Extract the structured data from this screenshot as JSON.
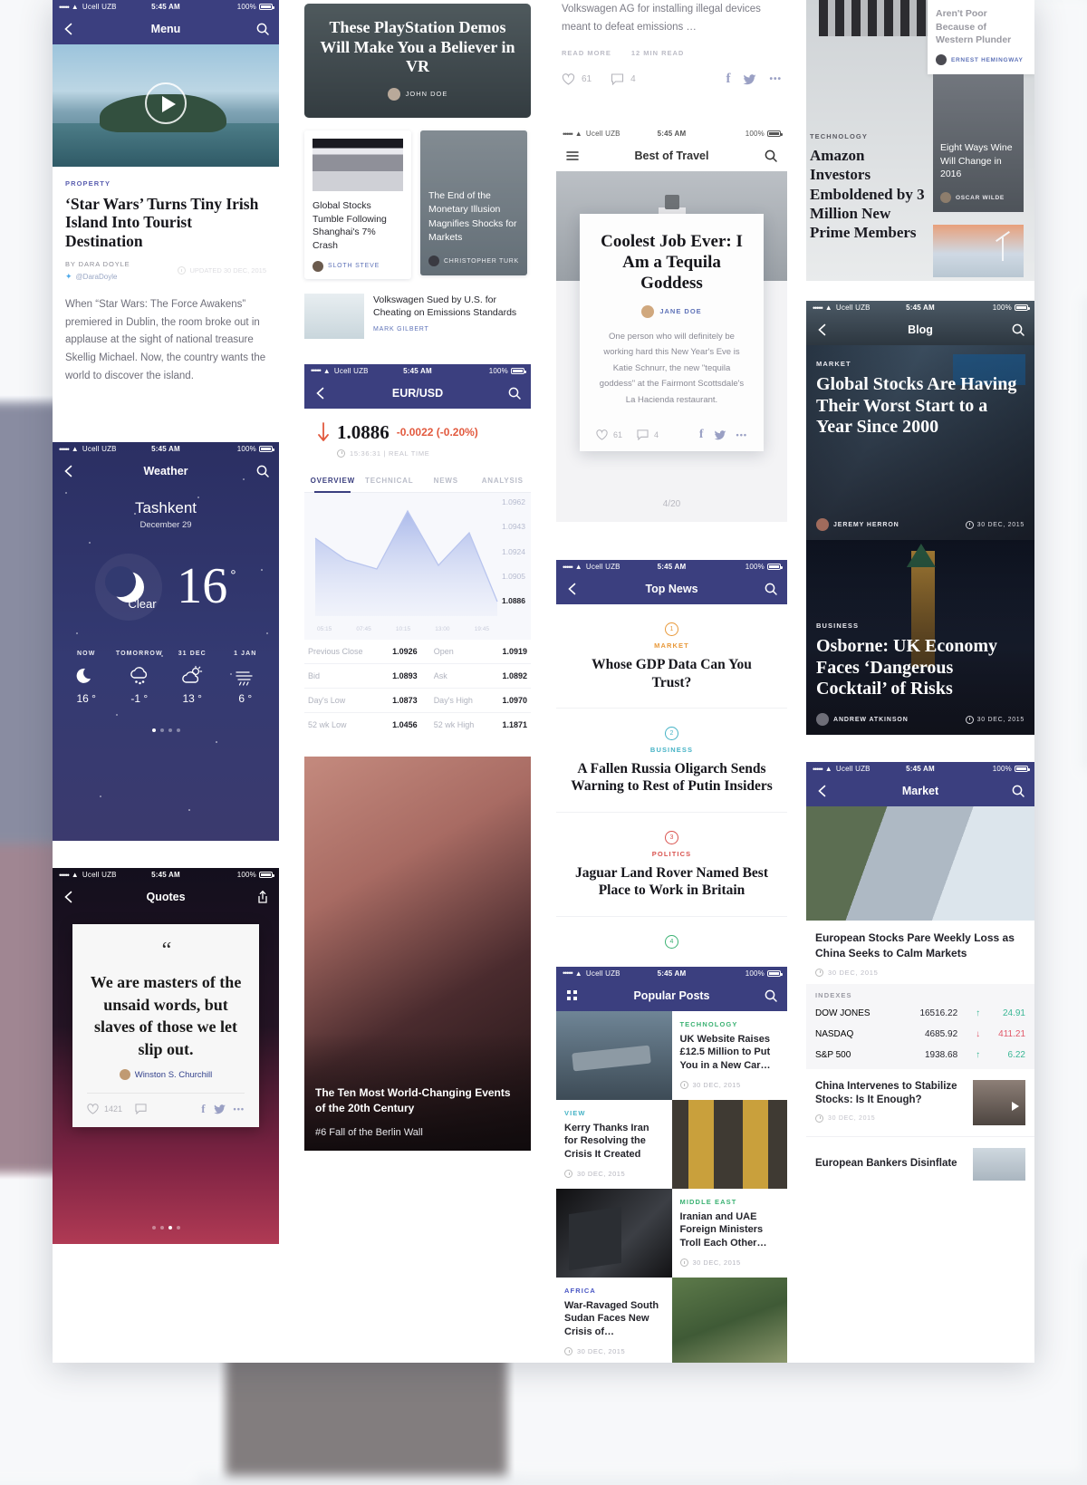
{
  "status_bar": {
    "carrier": "Ucell UZB",
    "time": "5:45 AM",
    "battery": "100%",
    "dots": "•••••"
  },
  "col1": {
    "menu_screen": {
      "nav_title": "Menu",
      "back_icon": "chevron-left-icon",
      "search_icon": "search-icon",
      "hero_icon": "play-icon",
      "kicker": "PROPERTY",
      "headline": "‘Star Wars’ Turns Tiny Irish Island Into Tourist Destination",
      "byline": "BY DARA DOYLE",
      "twitter_handle": "@DaraDoyle",
      "updated": "UPDATED 30 DEC, 2015",
      "body": "When “Star Wars: The Force Awakens” premiered in Dublin, the room broke out in applause at the sight of national treasure Skellig Michael. Now, the country wants the world to discover the island."
    },
    "weather_screen": {
      "nav_title": "Weather",
      "city": "Tashkent",
      "date": "December 29",
      "temp": "16",
      "degree": "°",
      "condition": "Clear",
      "forecast": [
        {
          "label": "NOW",
          "icon": "moon-icon",
          "temp": "16 °"
        },
        {
          "label": "TOMORROW",
          "icon": "snow-cloud-icon",
          "temp": "-1 °"
        },
        {
          "label": "31 DEC",
          "icon": "sun-cloud-icon",
          "temp": "13 °"
        },
        {
          "label": "1 JAN",
          "icon": "wind-rain-icon",
          "temp": "6 °"
        }
      ],
      "page_dots": 4,
      "page_active": 1
    },
    "quotes_screen": {
      "nav_title": "Quotes",
      "share_icon": "share-icon",
      "quote_mark": "“",
      "quote": "We are masters of the unsaid words, but slaves of those we let slip out.",
      "author": "Winston S. Churchill",
      "likes": "1421",
      "comment_icon": "comment-icon",
      "facebook_icon": "facebook-icon",
      "twitter_icon": "twitter-icon",
      "more_icon": "more-icon",
      "page_dots": 4,
      "page_active": 3
    }
  },
  "col2": {
    "feature_card": {
      "title": "These PlayStation Demos Will Make You a Believer in VR",
      "author": "JOHN DOE"
    },
    "small_cards": [
      {
        "title": "Global Stocks Tumble Following Shanghai's 7% Crash",
        "author": "SLOTH STEVE",
        "style": "light"
      },
      {
        "title": "The End of the Monetary Illusion Magnifies Shocks for Markets",
        "author": "CHRISTOPHER TURK",
        "style": "photo"
      }
    ],
    "list_card": {
      "title": "Volkswagen Sued by U.S. for Cheating on Emissions Standards",
      "author": "MARK GILBERT"
    },
    "forex_screen": {
      "nav_title": "EUR/USD",
      "price": "1.0886",
      "change": "-0.0022 (-0.20%)",
      "arrow_icon": "arrow-down-icon",
      "timestamp": "15:36:31 | REAL TIME",
      "tabs": [
        "OVERVIEW",
        "TECHNICAL",
        "NEWS",
        "ANALYSIS"
      ],
      "active_tab": "OVERVIEW",
      "stats": [
        {
          "l1": "Previous Close",
          "v1": "1.0926",
          "l2": "Open",
          "v2": "1.0919"
        },
        {
          "l1": "Bid",
          "v1": "1.0893",
          "l2": "Ask",
          "v2": "1.0892"
        },
        {
          "l1": "Day's Low",
          "v1": "1.0873",
          "l2": "Day's High",
          "v2": "1.0970"
        },
        {
          "l1": "52 wk Low",
          "v1": "1.0456",
          "l2": "52 wk High",
          "v2": "1.1871"
        }
      ]
    },
    "berlin_card": {
      "title": "The Ten Most World-Changing Events of the 20th Century",
      "subtitle": "#6 Fall of the Berlin Wall"
    }
  },
  "col3": {
    "article_tail": {
      "body": "Volkswagen AG for installing illegal devices meant to defeat emissions …",
      "read_more": "READ MORE",
      "read_time": "12 MIN READ",
      "likes": "61",
      "comments": "4",
      "facebook_icon": "facebook-icon",
      "twitter_icon": "twitter-icon",
      "more_icon": "more-icon"
    },
    "travel_screen": {
      "nav_title": "Best of Travel",
      "menu_icon": "hamburger-icon",
      "search_icon": "search-icon",
      "card_title": "Coolest Job Ever: I Am a Tequila Goddess",
      "author": "JANE DOE",
      "body": "One person who will definitely be working hard this New Year's Eve is Katie Schnurr, the new \"tequila goddess\" at the Fairmont Scottsdale's La Hacienda restaurant.",
      "likes": "61",
      "comments": "4",
      "pager": "4/20"
    },
    "topnews_screen": {
      "nav_title": "Top News",
      "items": [
        {
          "rank": "1",
          "kicker": "MARKET",
          "kicker_color": "#e8993a",
          "headline": "Whose GDP Data Can You Trust?"
        },
        {
          "rank": "2",
          "kicker": "BUSINESS",
          "kicker_color": "#46b3c6",
          "headline": "A Fallen Russia Oligarch Sends Warning to Rest of Putin Insiders"
        },
        {
          "rank": "3",
          "kicker": "POLITICS",
          "kicker_color": "#d9534f",
          "headline": "Jaguar Land Rover Named Best Place to Work in Britain"
        },
        {
          "rank": "4",
          "kicker": "",
          "kicker_color": "#3bb273",
          "headline": ""
        }
      ]
    },
    "popular_screen": {
      "nav_title": "Popular Posts",
      "menu_icon": "grid-icon",
      "posts": [
        {
          "kicker": "TECHNOLOGY",
          "kicker_color": "#3bb273",
          "title": "UK Website Raises £12.5 Million to Put You in a New Car…",
          "date": "30 DEC, 2015"
        },
        {
          "kicker": "VIEW",
          "kicker_color": "#46b3c6",
          "title": "Kerry Thanks Iran for Resolving the Crisis It Created",
          "date": "30 DEC, 2015"
        },
        {
          "kicker": "MIDDLE EAST",
          "kicker_color": "#3bb273",
          "title": "Iranian and UAE Foreign Ministers Troll Each Other…",
          "date": "30 DEC, 2015"
        },
        {
          "kicker": "AFRICA",
          "kicker_color": "#4a57c4",
          "title": "War-Ravaged South Sudan Faces New Crisis of…",
          "date": "30 DEC, 2015"
        }
      ]
    }
  },
  "col4": {
    "magazine": {
      "side_card": {
        "title": "Aren't Poor Because of Western Plunder",
        "author": "ERNEST HEMINGWAY"
      },
      "main_card": {
        "kicker": "TECHNOLOGY",
        "title": "Amazon Investors Emboldened by 3 Million New Prime Members"
      },
      "wine_card": {
        "title": "Eight Ways Wine Will Change in 2016",
        "author": "OSCAR WILDE"
      }
    },
    "blog_screen": {
      "nav_title": "Blog",
      "posts": [
        {
          "kicker": "MARKET",
          "title": "Global Stocks Are Having Their Worst Start to a Year Since 2000",
          "author": "JEREMY HERRON",
          "date": "30 DEC, 2015"
        },
        {
          "kicker": "BUSINESS",
          "title": "Osborne: UK Economy Faces ‘Dangerous Cocktail’ of Risks",
          "author": "ANDREW ATKINSON",
          "date": "30 DEC, 2015"
        }
      ]
    },
    "market_screen": {
      "nav_title": "Market",
      "lead_title": "European Stocks Pare Weekly Loss as China Seeks to Calm Markets",
      "lead_date": "30 DEC, 2015",
      "indexes_label": "INDEXES",
      "indexes": [
        {
          "name": "DOW JONES",
          "value": "16516.22",
          "dir": "up",
          "delta": "24.91"
        },
        {
          "name": "NASDAQ",
          "value": "4685.92",
          "dir": "down",
          "delta": "411.21"
        },
        {
          "name": "S&P 500",
          "value": "1938.68",
          "dir": "up",
          "delta": "6.22"
        }
      ],
      "rows": [
        {
          "title": "China Intervenes to Stabilize Stocks: Is It Enough?",
          "date": "30 DEC, 2015",
          "has_play": true
        },
        {
          "title": "European Bankers Disinflate",
          "date": "",
          "has_play": false
        }
      ]
    }
  },
  "chart_data": {
    "type": "line",
    "title": "EUR/USD",
    "x": [
      "05:15",
      "07:45",
      "10:15",
      "13:00",
      "19:45"
    ],
    "xlabel": "",
    "ylabel": "",
    "y_ticks": [
      "1.0962",
      "1.0943",
      "1.0924",
      "1.0905",
      "1.0886"
    ],
    "ylim": [
      1.0886,
      1.0962
    ],
    "series": [
      {
        "name": "EUR/USD",
        "values": [
          1.0932,
          1.0912,
          1.0905,
          1.0958,
          1.0914,
          1.0941,
          1.0886
        ]
      }
    ],
    "current_value": "1.0886",
    "legend": "none",
    "grid": false
  }
}
